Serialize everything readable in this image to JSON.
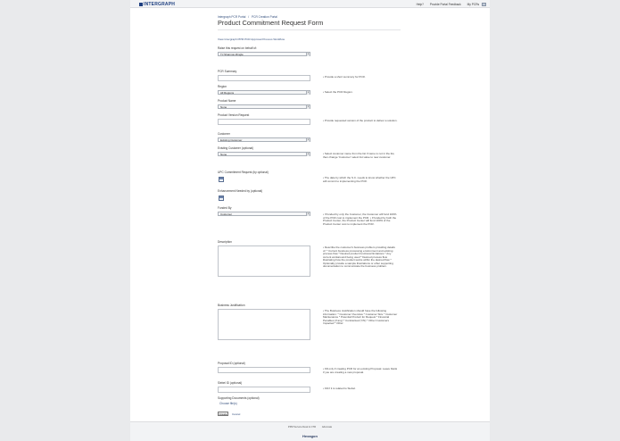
{
  "header": {
    "logo_text": "INTERGRAPH",
    "nav": [
      "Help?",
      "Provide Portal Feedback",
      "My PCRs"
    ]
  },
  "breadcrumb": [
    "Intergraph PCR Portal",
    "/",
    "PCR Creation Portal"
  ],
  "page_title": "Product Commitment Request Form",
  "view_link": "View Intergraph PPM PCR Approval Process Workflow",
  "fields": {
    "raise_on_behalf": {
      "label": "Raise this request on behalf of:",
      "value": "TJ Shannon-Ringle"
    },
    "summary": {
      "label": "PCR Summary",
      "help": "• Provide a short summary for PCR."
    },
    "region": {
      "label": "Region",
      "value": "All Regions",
      "help": "• Select the PCR Region."
    },
    "product_name": {
      "label": "Product Name",
      "value": "None"
    },
    "product_version": {
      "label": "Product Version Request",
      "help": "• Provide requested version of the product to deliver a solution."
    },
    "customer": {
      "label": "Customer",
      "value": "Existing Customer"
    },
    "existing_customer": {
      "label": "Existing Customer (optional)",
      "value": "None",
      "help": "• Select customer name from the list if name is not in the list, then change 'Customer' select list value to new customer."
    },
    "upc_commitment": {
      "label": "UPC Commitment Request (by optional)",
      "help": "• The date by which the S.C. needs to know whether the UPC will commit to implementing the PCR."
    },
    "enhancement_needed": {
      "label": "Enhancement Needed by (optional)"
    },
    "funded_by": {
      "label": "Funded By",
      "value": "Customer",
      "help": "• If funded by only the Customer, the Customer will fund 100% of the PCR cost to implement the PCR. • If funded by both the Product Center, the Product Center will fund 100% of the Product Center cost to implement the PCR."
    },
    "description": {
      "label": "Description",
      "help": "• Describe the customer's business problem providing details of: * Current business processing environment and existing process flow * Desired product functional limitations * Any current workaround being used * Desired process flow illustrating how the product works within the desired flow * Optionally provide a sample illustrations or other supporting documentation to communicate the business problem."
    },
    "business_justification": {
      "label": "Business Justification",
      "help": "• The Business Justification should have the following information: * Customer Overview * Customer Size * Customer Maintenance * Potential Product for Request * Financial Penalties (if any) * Contractual (Y/N) * Other Customers Impacted * Other"
    },
    "proposal_id": {
      "label": "Proposal ID (optional)",
      "help": "• Fill only if creating PCR for an existing Proposal. Leave blank if you are creating a new proposal."
    },
    "siebel_id": {
      "label": "Siebel ID (optional)",
      "help": "• Fill if it is related to Siebel."
    },
    "supporting_docs": {
      "label": "Supporting Documents (optional)",
      "choose_label": "Choose file(s)"
    }
  },
  "actions": {
    "submit": "Create",
    "cancel": "Cancel"
  },
  "footer": {
    "links": [
      "PPM Service Desk & CTR",
      "Advocate"
    ],
    "logo": "Hexagon"
  }
}
